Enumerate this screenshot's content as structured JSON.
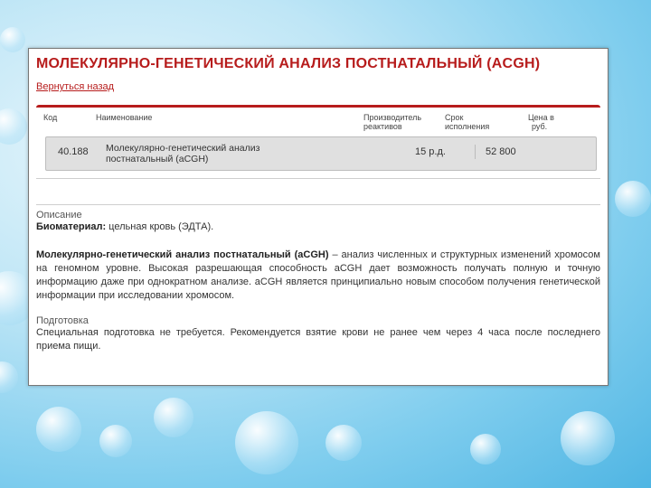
{
  "page": {
    "title": "МОЛЕКУЛЯРНО-ГЕНЕТИЧЕСКИЙ АНАЛИЗ ПОСТНАТАЛЬНЫЙ (ACGH)",
    "back_link": "Вернуться назад"
  },
  "table": {
    "headers": {
      "code": "Код",
      "name": "Наименование",
      "execution_line1": "Производитель",
      "execution_line2": "реактивов",
      "term_line1": "Срок",
      "term_line2": "исполнения",
      "price_line1": "Цена в",
      "price_line2": "руб."
    },
    "row": {
      "code": "40.188",
      "name_line1": "Молекулярно-генетический анализ",
      "name_line2": "постнатальный (aCGH)",
      "term": "15 р.д.",
      "price": "52 800"
    }
  },
  "description": {
    "heading": "Описание",
    "biomaterial_label": "Биоматериал:",
    "biomaterial_value": " цельная кровь (ЭДТА).",
    "main_label": "Молекулярно-генетический анализ постнатальный (aCGH)",
    "main_text": " – анализ численных и структурных изменений хромосом на геномном уровне. Высокая разрешающая способность aCGH дает возможность получать полную и точную информацию даже при однократном анализе. aCGH является принципиально новым способом получения генетической информации при исследовании хромосом."
  },
  "preparation": {
    "heading": "Подготовка",
    "text": "Специальная подготовка не требуется. Рекомендуется взятие крови не ранее чем через 4 часа после последнего приема пищи."
  }
}
